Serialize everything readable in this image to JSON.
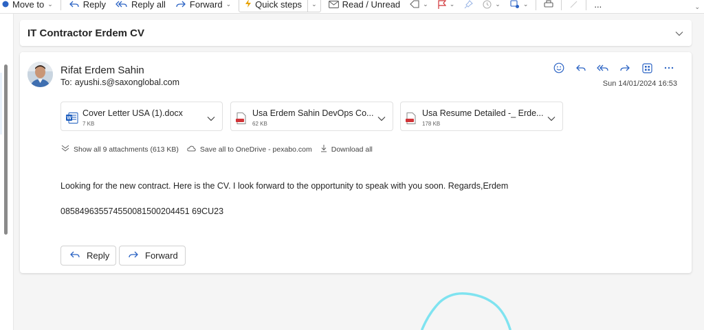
{
  "toolbar": {
    "move_to": "Move to",
    "reply": "Reply",
    "reply_all": "Reply all",
    "forward": "Forward",
    "quick_steps": "Quick steps",
    "read_unread": "Read / Unread",
    "more": "..."
  },
  "subject": {
    "title": "IT Contractor Erdem CV"
  },
  "message": {
    "sender_name": "Rifat Erdem Sahin",
    "to_label": "To:",
    "to_address": "ayushi.s@saxonglobal.com",
    "date": "Sun 14/01/2024 16:53",
    "body": "Looking for the new contract. Here is the CV. I look forward to the opportunity to speak with you soon. Regards,Erdem",
    "code": "085849635574550081500204451 69CU23"
  },
  "attachments": [
    {
      "name": "Cover Letter USA (1).docx",
      "size": "7 KB",
      "type": "word"
    },
    {
      "name": "Usa Erdem Sahin DevOps Co...",
      "size": "62 KB",
      "type": "pdf"
    },
    {
      "name": "Usa Resume Detailed -_ Erde...",
      "size": "178 KB",
      "type": "pdf"
    }
  ],
  "attachment_links": {
    "show_all": "Show all 9 attachments (613 KB)",
    "save_onedrive": "Save all to OneDrive - pexabo.com",
    "download_all": "Download all"
  },
  "buttons": {
    "reply": "Reply",
    "forward": "Forward"
  },
  "colors": {
    "accent": "#2b63c4",
    "word": "#185abd",
    "pdf": "#d13438",
    "doodle": "#7fe3f0"
  }
}
